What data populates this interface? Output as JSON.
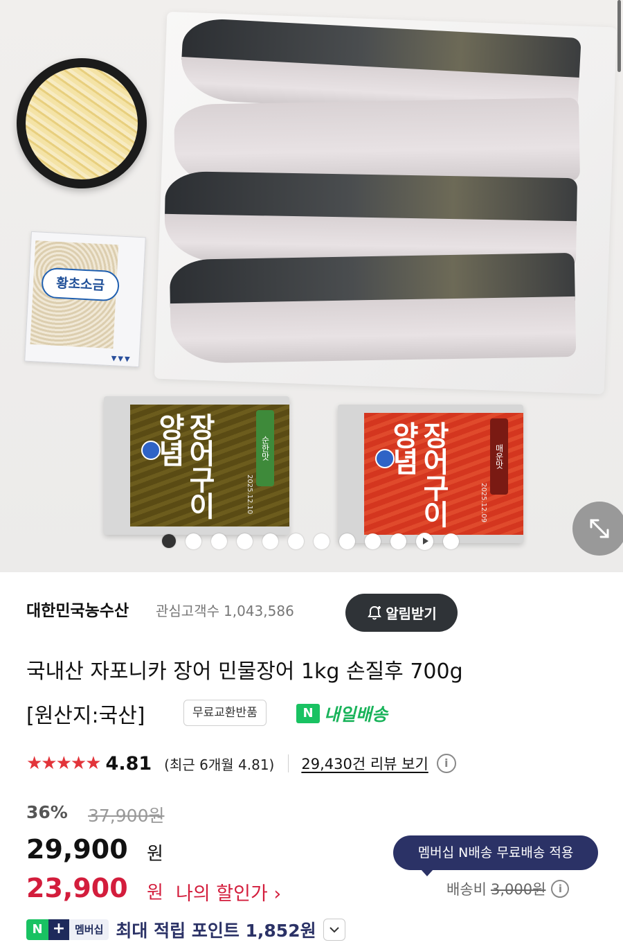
{
  "hero": {
    "salt_packet_label": "황초소금",
    "sauce_a": {
      "brush_text": "장어구이양념",
      "tag": "순한맛",
      "date": "2025.12.10"
    },
    "sauce_b": {
      "brush_text": "장어구이양념",
      "tag": "매운맛",
      "date": "2025.12.09"
    },
    "carousel": {
      "total": 12,
      "active_index": 0,
      "play_index": 10
    }
  },
  "store": {
    "name": "대한민국농수산",
    "fans_label": "관심고객수",
    "fans_count": "1,043,586",
    "alarm_button": "알림받기"
  },
  "product": {
    "title_line1": "국내산 자포니카 장어 민물장어 1kg 손질후 700g",
    "title_line2": "[원산지:국산]",
    "free_exchange_badge": "무료교환반품",
    "delivery_badge_letter": "N",
    "delivery_badge_label": "내일배송"
  },
  "rating": {
    "stars": "★★★★★",
    "score": "4.81",
    "recent": "(최근 6개월 4.81)",
    "reviews_link": "29,430건 리뷰 보기",
    "info_icon": "i"
  },
  "price": {
    "discount_rate": "36%",
    "original": "37,900원",
    "current": "29,900",
    "current_unit": "원",
    "my_price": "23,900",
    "my_price_unit": "원",
    "my_price_label": "나의 할인가 ›"
  },
  "shipping": {
    "membership_tooltip": "멤버십 N배송 무료배송 적용",
    "label": "배송비",
    "fee": "3,000원",
    "info_icon": "i"
  },
  "points": {
    "badge_n": "N",
    "badge_plus": "+",
    "badge_member": "멤버십",
    "text": "최대 적립 포인트 1,852원"
  },
  "colors": {
    "accent_red": "#d31d3c",
    "naver_green": "#19c262",
    "membership_navy": "#2b3266",
    "star_red": "#e2343a"
  }
}
